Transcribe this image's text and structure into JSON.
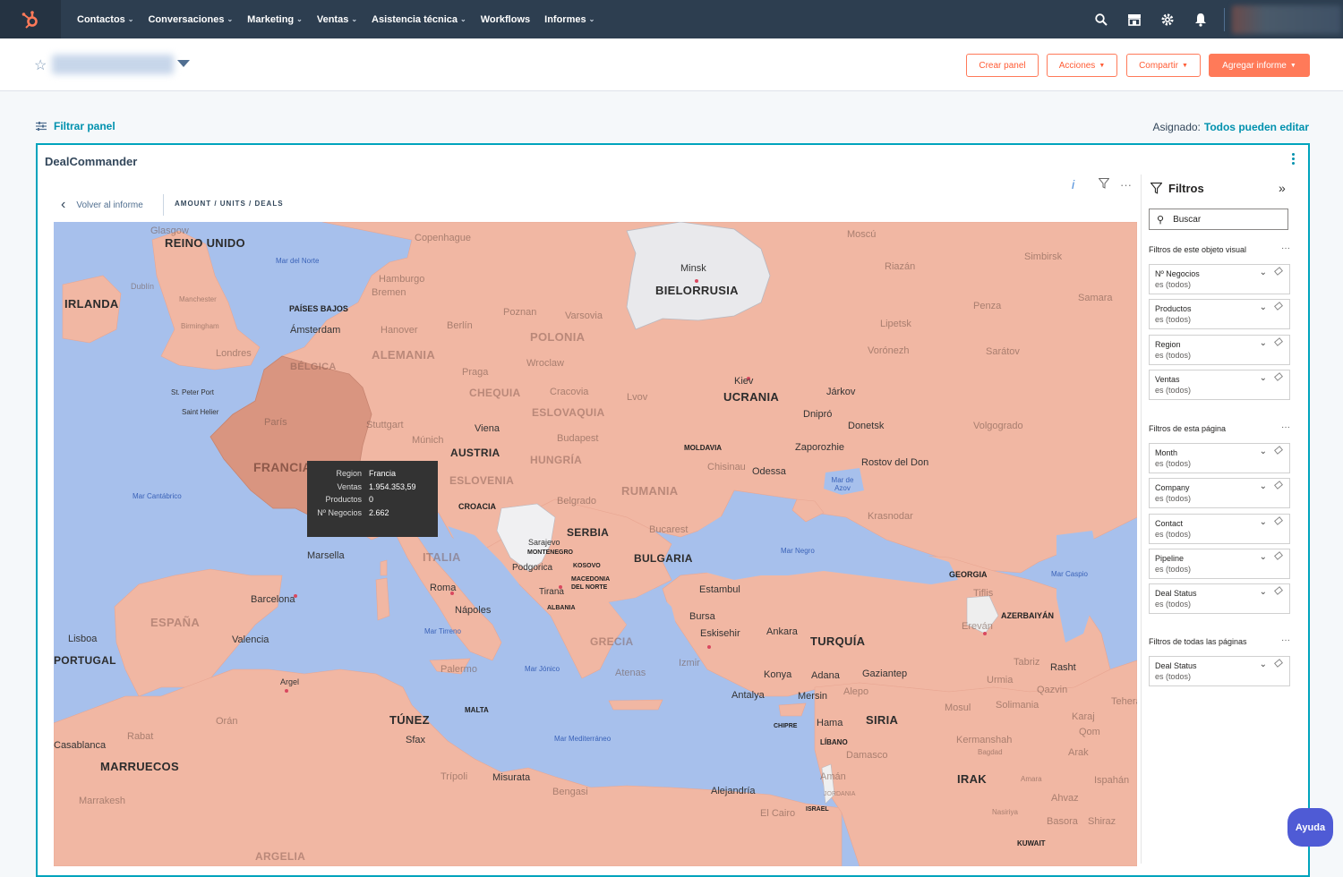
{
  "nav": {
    "items": [
      {
        "label": "Contactos",
        "has_menu": true
      },
      {
        "label": "Conversaciones",
        "has_menu": true
      },
      {
        "label": "Marketing",
        "has_menu": true
      },
      {
        "label": "Ventas",
        "has_menu": true
      },
      {
        "label": "Asistencia técnica",
        "has_menu": true
      },
      {
        "label": "Workflows",
        "has_menu": false
      },
      {
        "label": "Informes",
        "has_menu": true
      }
    ],
    "icons": [
      "search-icon",
      "marketplace-icon",
      "settings-icon",
      "notifications-icon"
    ]
  },
  "header": {
    "create_dashboard": "Crear panel",
    "actions": "Acciones",
    "share": "Compartir",
    "add_report": "Agregar informe"
  },
  "filterbar": {
    "filter_label": "Filtrar panel",
    "assigned_label": "Asignado:",
    "assigned_value": "Todos pueden editar"
  },
  "report": {
    "title": "DealCommander",
    "back_label": "Volver al informe",
    "breadcrumb": "AMOUNT / UNITS / DEALS"
  },
  "map": {
    "countries": [
      "REINO UNIDO",
      "IRLANDA",
      "PAÍSES BAJOS",
      "BÉLGICA",
      "ALEMANIA",
      "POLONIA",
      "BIELORRUSIA",
      "UCRANIA",
      "CHEQUIA",
      "ESLOVAQUIA",
      "AUSTRIA",
      "HUNGRÍA",
      "ESLOVENIA",
      "FRANCIA",
      "RUMANIA",
      "MOLDAVIA",
      "CROACIA",
      "SERBIA",
      "BULGARIA",
      "ITALIA",
      "ESPAÑA",
      "PORTUGAL",
      "GRECIA",
      "TURQUÍA",
      "GEORGIA",
      "AZERBAIYÁN",
      "SIRIA",
      "IRAK",
      "MARRUECOS",
      "TÚNEZ",
      "LÍBANO",
      "CHIPRE",
      "KUWAIT",
      "ALBANIA",
      "MONTENEGRO",
      "KOSOVO",
      "MACEDONIA DEL NORTE",
      "MALTA",
      "ISRAEL",
      "JORDANIA",
      "ARGELIA"
    ],
    "seas": [
      "Mar del Norte",
      "Mar Cantábrico",
      "Mar Negro",
      "Mar de Azov",
      "Mar Caspio",
      "Mar Tirreno",
      "Mar Jónico",
      "Mar Mediterráneo"
    ],
    "cities": [
      "Glasgow",
      "Copenhague",
      "Moscú",
      "Minsk",
      "Hamburgo",
      "Bremen",
      "Dublín",
      "Ámsterdam",
      "Hanover",
      "Berlín",
      "Poznan",
      "Varsovia",
      "Riazán",
      "Simbirsk",
      "Samara",
      "Londres",
      "Birmingham",
      "Manchester",
      "Kiev",
      "Lipetsk",
      "Penza",
      "Vorónezh",
      "Sarátov",
      "Járkov",
      "Dnipró",
      "Donetsk",
      "Lvov",
      "Praga",
      "Wroclaw",
      "Cracovia",
      "St. Peter Port",
      "Saint Helier",
      "París",
      "Stuttgart",
      "Múnich",
      "Viena",
      "Budapest",
      "Zaporozhie",
      "Volgogrado",
      "Chisinau",
      "Odessa",
      "Rostov del Don",
      "Krasnodar",
      "Belgrado",
      "Bucarest",
      "Sarajevo",
      "Podgorica",
      "Tirana",
      "Marsella",
      "Barcelona",
      "Roma",
      "Nápoles",
      "Estambul",
      "Tiflis",
      "Ereván",
      "Bursa",
      "Eskisehir",
      "Ankara",
      "Lisboa",
      "Valencia",
      "Atenas",
      "Izmir",
      "Konya",
      "Adana",
      "Gaziantep",
      "Mersin",
      "Alepo",
      "Antalya",
      "Tabriz",
      "Urmia",
      "Qazvin",
      "Rasht",
      "Teherán",
      "Mosul",
      "Solimania",
      "Karaj",
      "Qom",
      "Arak",
      "Palermo",
      "Argel",
      "Orán",
      "Rabat",
      "Casablanca",
      "Marrakesh",
      "Sfax",
      "Trípoli",
      "Misurata",
      "Bengasi",
      "Alejandría",
      "El Cairo",
      "Hama",
      "Damasco",
      "Amán",
      "Kermanshah",
      "Bagdad",
      "Ispahán",
      "Basora",
      "Ahvaz",
      "Shiraz",
      "Nasiriya",
      "Amara"
    ],
    "tooltip": {
      "rows": [
        {
          "label": "Region",
          "value": "Francia"
        },
        {
          "label": "Ventas",
          "value": "1.954.353,59"
        },
        {
          "label": "Productos",
          "value": "0"
        },
        {
          "label": "Nº Negocios",
          "value": "2.662"
        }
      ]
    },
    "colors": {
      "sea": "#a7c0ec",
      "land_data": "#f1b7a3",
      "france": "#d99580",
      "belarus": "#e9e9ec",
      "no_data_land": "#f0f0f0"
    }
  },
  "filters_pane": {
    "title": "Filtros",
    "search_placeholder": "Buscar",
    "sections": [
      {
        "title": "Filtros de este objeto visual",
        "items": [
          {
            "name": "Nº Negocios",
            "value": "es (todos)"
          },
          {
            "name": "Productos",
            "value": "es (todos)"
          },
          {
            "name": "Region",
            "value": "es (todos)"
          },
          {
            "name": "Ventas",
            "value": "es (todos)"
          }
        ]
      },
      {
        "title": "Filtros de esta página",
        "items": [
          {
            "name": "Month",
            "value": "es (todos)"
          },
          {
            "name": "Company",
            "value": "es (todos)"
          },
          {
            "name": "Contact",
            "value": "es (todos)"
          },
          {
            "name": "Pipeline",
            "value": "es (todos)"
          },
          {
            "name": "Deal Status",
            "value": "es (todos)"
          }
        ]
      },
      {
        "title": "Filtros de todas las páginas",
        "items": [
          {
            "name": "Deal Status",
            "value": "es (todos)"
          }
        ]
      }
    ]
  },
  "help": {
    "label": "Ayuda"
  }
}
